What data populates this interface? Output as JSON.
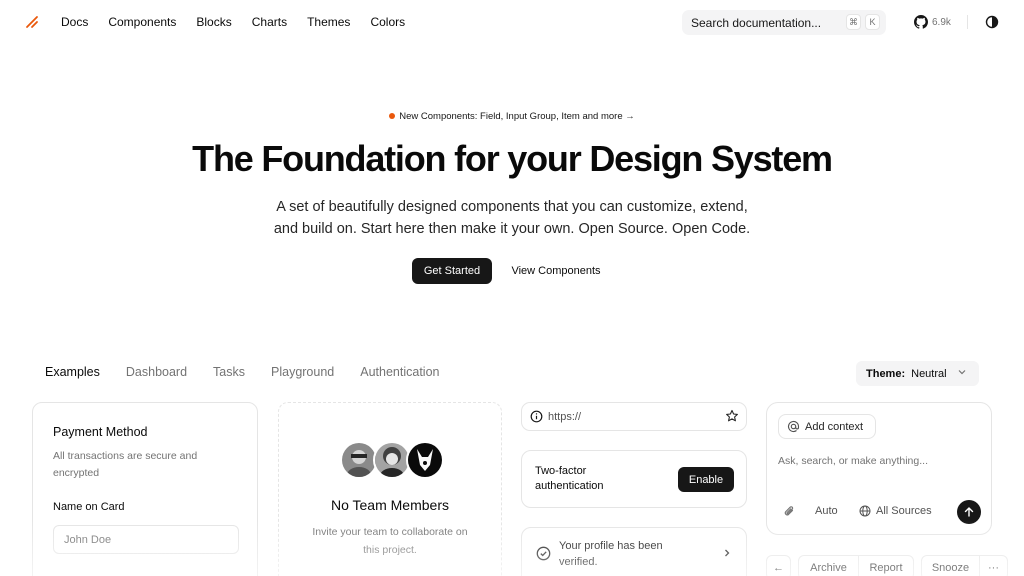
{
  "header": {
    "nav": [
      "Docs",
      "Components",
      "Blocks",
      "Charts",
      "Themes",
      "Colors"
    ],
    "search_placeholder": "Search documentation...",
    "kbd_cmd": "⌘",
    "kbd_k": "K",
    "github_stars": "6.9k",
    "icons": {
      "logo": "slash-logo-icon",
      "github": "github-icon",
      "theme": "contrast-icon"
    },
    "accent": "#ea580c"
  },
  "hero": {
    "announcement": "New Components: Field, Input Group, Item and more",
    "announcement_arrow": "→",
    "title": "The Foundation for your Design System",
    "subtitle_line1": "A set of beautifully designed components that you can customize, extend,",
    "subtitle_line2": "and build on. Start here then make it your own. Open Source. Open Code.",
    "primary_button": "Get Started",
    "secondary_button": "View Components"
  },
  "examples": {
    "tabs": [
      "Examples",
      "Dashboard",
      "Tasks",
      "Playground",
      "Authentication"
    ],
    "theme_label": "Theme:",
    "theme_value": "Neutral"
  },
  "payment": {
    "title": "Payment Method",
    "description": "All transactions are secure and encrypted",
    "name_label": "Name on Card",
    "name_placeholder": "John Doe"
  },
  "team": {
    "title": "No Team Members",
    "description": "Invite your team to collaborate on this project."
  },
  "url_input": {
    "placeholder": "https://"
  },
  "two_factor": {
    "label": "Two-factor authentication",
    "button": "Enable"
  },
  "profile": {
    "text": "Your profile has been verified."
  },
  "prompt": {
    "add_context": "Add context",
    "placeholder": "Ask, search, or make anything...",
    "mode": "Auto",
    "sources": "All Sources"
  },
  "actions": {
    "archive": "Archive",
    "report": "Report",
    "snooze": "Snooze",
    "more": "···",
    "back": "←"
  }
}
